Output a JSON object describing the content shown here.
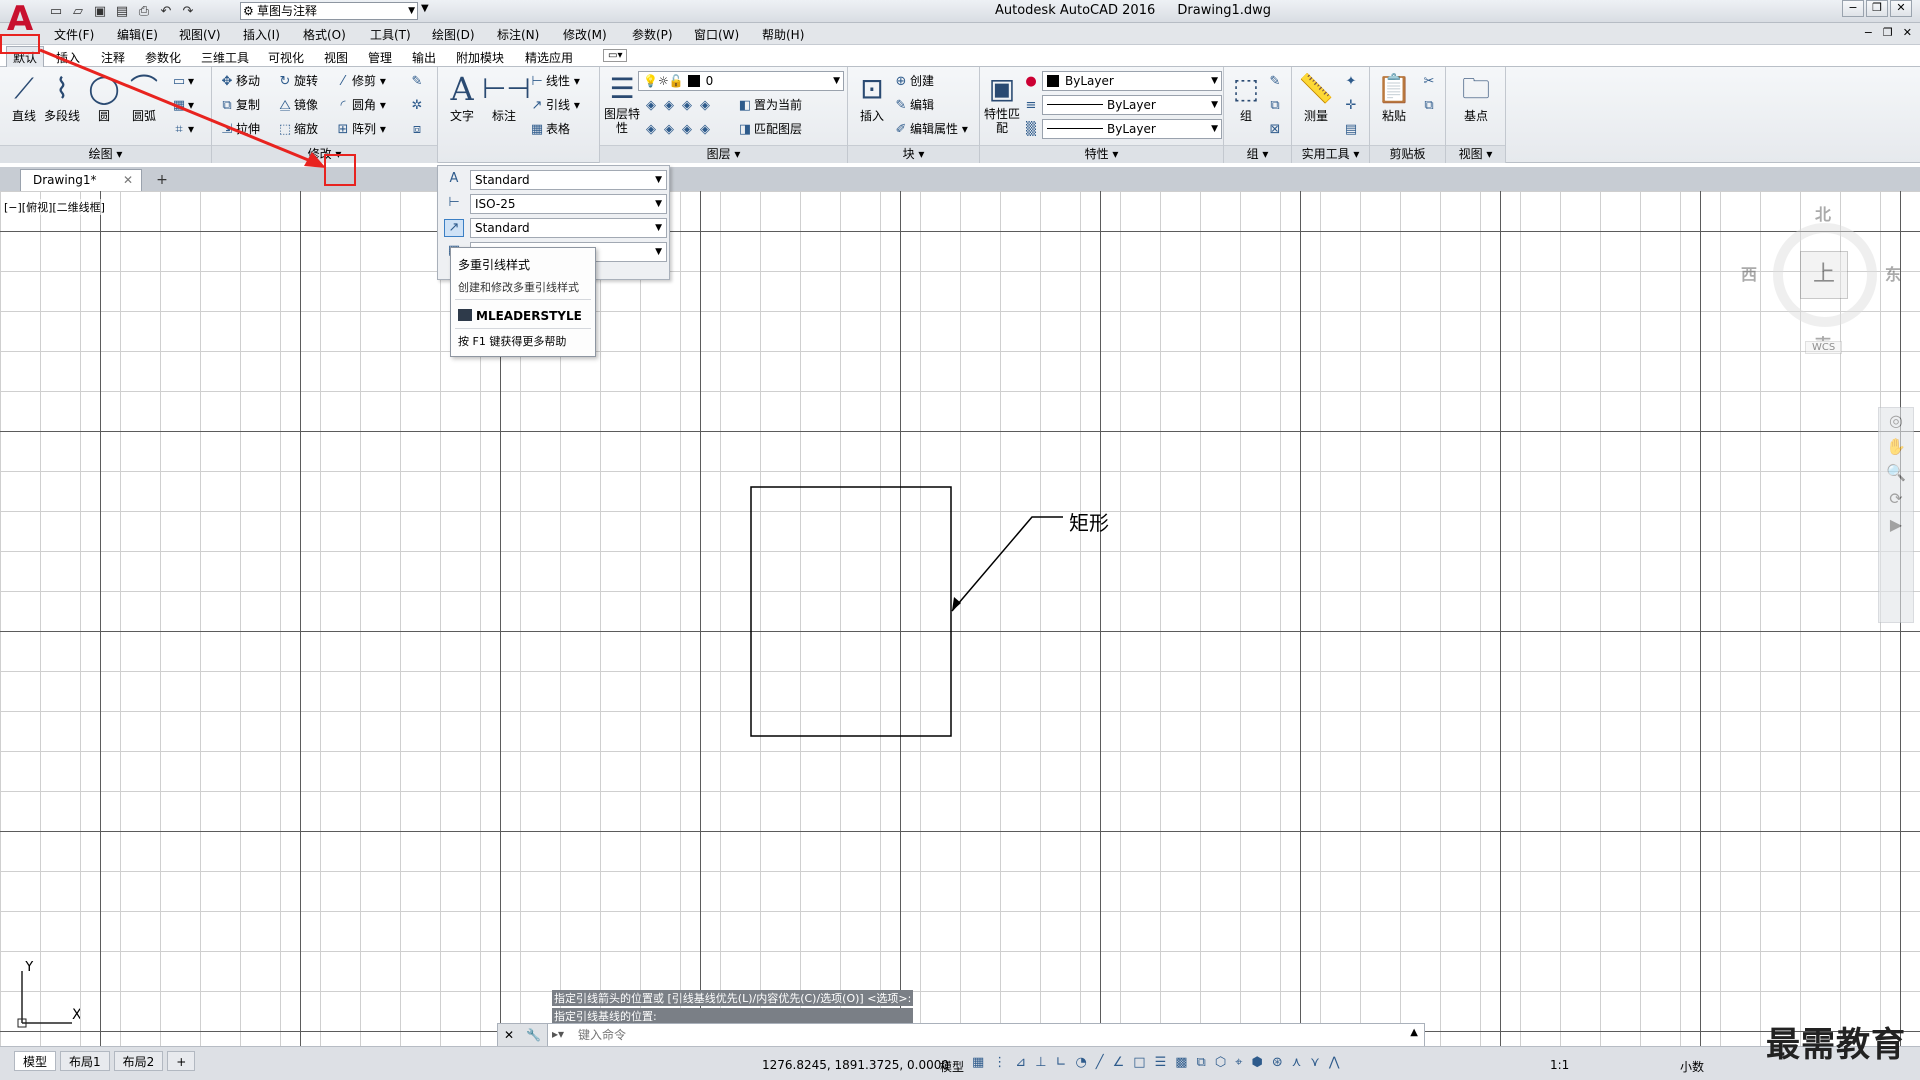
{
  "titlebar": {
    "app_name": "Autodesk AutoCAD 2016",
    "file_name": "Drawing1.dwg",
    "workspace": "草图与注释"
  },
  "menu": [
    "文件(F)",
    "编辑(E)",
    "视图(V)",
    "插入(I)",
    "格式(O)",
    "工具(T)",
    "绘图(D)",
    "标注(N)",
    "修改(M)",
    "参数(P)",
    "窗口(W)",
    "帮助(H)"
  ],
  "ribbon_tabs": [
    "默认",
    "插入",
    "注释",
    "参数化",
    "三维工具",
    "可视化",
    "视图",
    "管理",
    "输出",
    "附加模块",
    "精选应用"
  ],
  "ribbon": {
    "draw": {
      "title": "绘图",
      "line": "直线",
      "polyline": "多段线",
      "circle": "圆",
      "arc": "圆弧"
    },
    "modify": {
      "title": "修改",
      "move": "移动",
      "rotate": "旋转",
      "trim": "修剪",
      "copy": "复制",
      "mirror": "镜像",
      "fillet": "圆角",
      "stretch": "拉伸",
      "scale": "缩放",
      "array": "阵列"
    },
    "annotation": {
      "text": "文字",
      "dimension": "标注",
      "linear": "线性",
      "leader": "引线",
      "table": "表格"
    },
    "layers": {
      "title": "图层",
      "properties": "图层特性",
      "current_layer": "0",
      "make_current": "置为当前",
      "match_layer": "匹配图层"
    },
    "block": {
      "title": "块",
      "insert": "插入",
      "create": "创建",
      "edit": "编辑",
      "edit_attributes": "编辑属性"
    },
    "properties": {
      "title": "特性",
      "match": "特性匹配",
      "color": "ByLayer",
      "linetype": "ByLayer",
      "lineweight": "ByLayer"
    },
    "groups": {
      "title": "组",
      "group": "组"
    },
    "utilities": {
      "title": "实用工具",
      "measure": "测量"
    },
    "clipboard": {
      "title": "剪贴板",
      "paste": "粘贴"
    },
    "view": {
      "title": "视图",
      "base": "基点"
    }
  },
  "doc_tab": {
    "name": "Drawing1*"
  },
  "viewport_label": "[−][俯视][二维线框]",
  "style_panel": {
    "text_style": "Standard",
    "dim_style": "ISO-25",
    "mleader_style": "Standard"
  },
  "tooltip": {
    "title": "多重引线样式",
    "description": "创建和修改多重引线样式",
    "command": "MLEADERSTYLE",
    "help": "按 F1 键获得更多帮助"
  },
  "drawing": {
    "leader_text": "矩形"
  },
  "viewcube": {
    "north": "北",
    "south": "南",
    "east": "东",
    "west": "西",
    "top": "上",
    "wcs": "WCS"
  },
  "ucs": {
    "x": "X",
    "y": "Y"
  },
  "command": {
    "history": [
      "指定引线箭头的位置或 [引线基线优先(L)/内容优先(C)/选项(O)] <选项>:",
      "指定引线基线的位置:"
    ],
    "placeholder": "键入命令"
  },
  "status": {
    "layout_tabs": [
      "模型",
      "布局1",
      "布局2"
    ],
    "coordinates": "1276.8245, 1891.3725, 0.0000",
    "model": "模型",
    "scale": "1:1",
    "units": "小数"
  },
  "watermark": "最需教育"
}
